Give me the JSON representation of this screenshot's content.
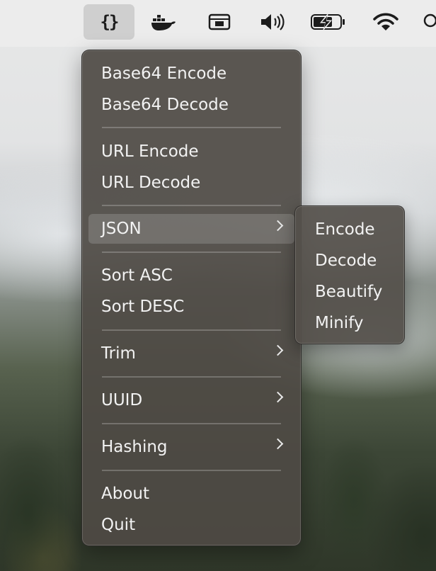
{
  "menubar": {
    "app_icon": "curly-braces-icon",
    "icons": [
      "docker-whale-icon",
      "keyboard-viewer-icon",
      "speaker-volume-icon",
      "battery-charging-icon",
      "wifi-icon",
      "search-icon"
    ]
  },
  "menu": {
    "items": [
      {
        "label": "Base64 Encode"
      },
      {
        "label": "Base64 Decode"
      },
      {
        "label": "URL Encode"
      },
      {
        "label": "URL Decode"
      },
      {
        "label": "JSON",
        "submenu": true,
        "highlighted": true
      },
      {
        "label": "Sort ASC"
      },
      {
        "label": "Sort DESC"
      },
      {
        "label": "Trim",
        "submenu": true
      },
      {
        "label": "UUID",
        "submenu": true
      },
      {
        "label": "Hashing",
        "submenu": true
      },
      {
        "label": "About"
      },
      {
        "label": "Quit"
      }
    ]
  },
  "json_submenu": {
    "items": [
      {
        "label": "Encode"
      },
      {
        "label": "Decode"
      },
      {
        "label": "Beautify"
      },
      {
        "label": "Minify"
      }
    ]
  },
  "colors": {
    "menu_bg": "#4e4a44",
    "menu_text": "#f2f2f2",
    "menubar_bg": "#ececec"
  }
}
